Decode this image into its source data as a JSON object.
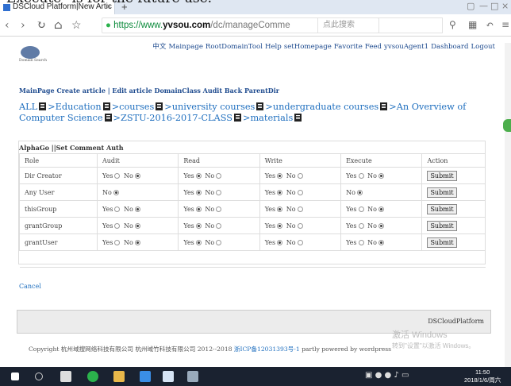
{
  "overtext": "\"Execute\" is for the future use.",
  "browser": {
    "tab_title": "DSCloud Platform|New Artic",
    "url_scheme": "https://www.",
    "url_host": "yvsou.com",
    "url_path": "/dc/manageComme",
    "search_placeholder": "点此搜索"
  },
  "topnav": [
    "中文",
    "Mainpage",
    "RootDomainTool",
    "Help",
    "setHomepage",
    "Favorite",
    "Feed",
    "yvsouAgent1",
    "Dashboard",
    "Logout"
  ],
  "logo_sub": "Domain Search",
  "actions": "MainPage Create article | Edit article DomainClass Audit Back ParentDir",
  "crumbs": [
    "ALL",
    "Education",
    "courses",
    "university courses",
    "undergraduate courses",
    "An Overview of Computer Science",
    "ZSTU-2016-2017-CLASS",
    "materials"
  ],
  "panel_title": "AlphaGo ||Set Comment Auth",
  "headers": [
    "Role",
    "Audit",
    "Read",
    "Write",
    "Execute",
    "Action"
  ],
  "rows": [
    {
      "role": "Dir Creator",
      "audit": "yes_no:no",
      "read": "yes_no:yes",
      "write": "yes_no:yes",
      "execute": "yes_no:no"
    },
    {
      "role": "Any User",
      "audit": "no:no",
      "read": "yes_no:yes",
      "write": "yes_no:yes",
      "execute": "no:no"
    },
    {
      "role": "thisGroup",
      "audit": "yes_no:no",
      "read": "yes_no:yes",
      "write": "yes_no:yes",
      "execute": "yes_no:no"
    },
    {
      "role": "grantGroup",
      "audit": "yes_no:no",
      "read": "yes_no:yes",
      "write": "yes_no:yes",
      "execute": "yes_no:no"
    },
    {
      "role": "grantUser",
      "audit": "yes_no:no",
      "read": "yes_no:yes",
      "write": "yes_no:yes",
      "execute": "yes_no:no"
    }
  ],
  "yes_label": "Yes",
  "no_label": "No",
  "submit_label": "Submit",
  "cancel_label": "Cancel",
  "footer_brand": "DSCloudPlatform",
  "copyright_pre": "Copyright 杭州域搜网络科技有限公司 杭州域竹科技有限公司 2012--2018 ",
  "copyright_icp": "浙ICP备12031393号-1",
  "copyright_post": " partly powered by wordpress",
  "watermark1": "激活 Windows",
  "watermark2": "转到\"设置\"以激活 Windows。",
  "clock_time": "11:50",
  "clock_date": "2018/1/6/周六"
}
